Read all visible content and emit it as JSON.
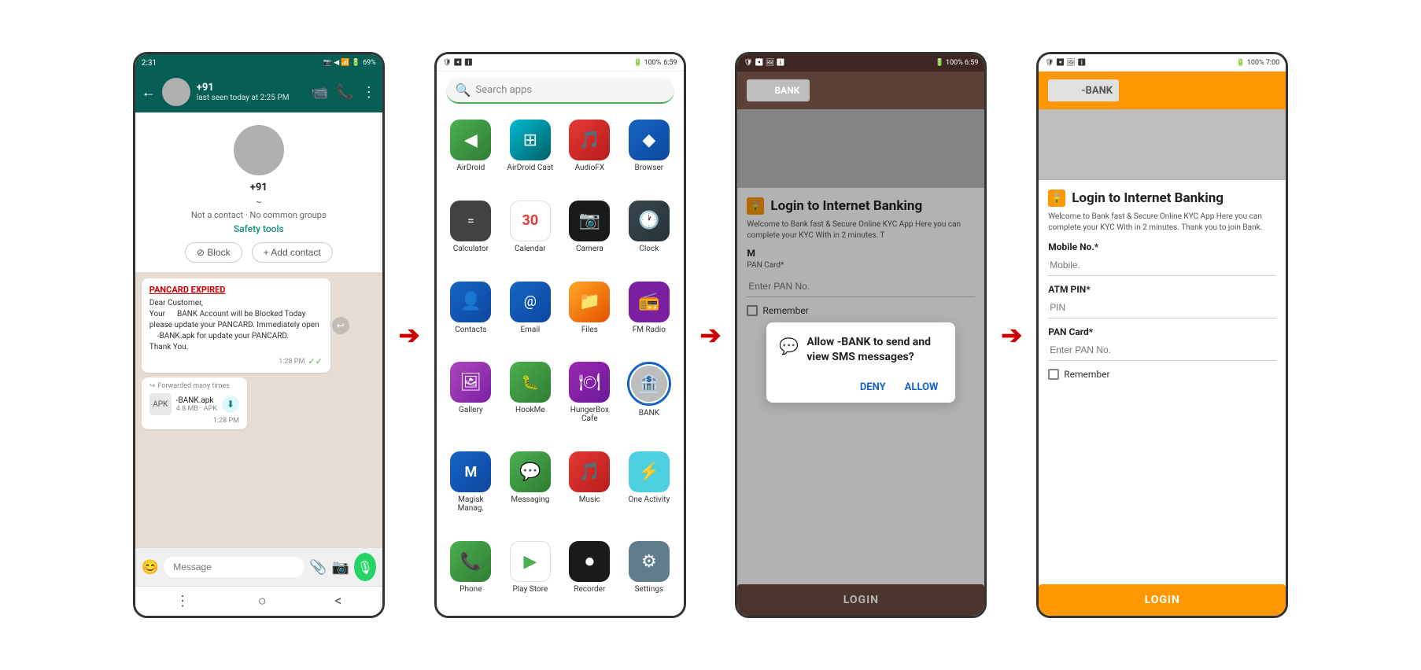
{
  "screen1": {
    "statusbar": {
      "time": "2:31",
      "battery": "69%"
    },
    "toolbar": {
      "back_label": "←",
      "contact_name": "+91",
      "contact_status": "last seen today at 2:25 PM",
      "video_icon": "📹",
      "phone_icon": "📞",
      "more_icon": "⋮"
    },
    "profile": {
      "phone_number": "+91",
      "tilde": "~",
      "no_contact_text": "Not a contact · No common groups",
      "safety_tools_label": "Safety tools"
    },
    "buttons": {
      "block_label": "⊘  Block",
      "add_contact_label": "+ Add contact"
    },
    "messages": [
      {
        "pancard_title": "PANCARD EXPIRED",
        "text": "Dear Customer,\nYour        BANK Account will be Blocked Today please update your PANCARD. Immediately open      -BANK.apk for update your PANCARD.\nThank You.",
        "time": "1:28 PM",
        "check": "✓✓"
      }
    ],
    "forwarded": {
      "label": "Forwarded many times",
      "filename": "-BANK.apk",
      "size": "4.8 MB · APK",
      "time": "1:28 PM"
    },
    "input_placeholder": "Message",
    "nav": {
      "menu": "⋮",
      "home": "○",
      "back": "<"
    }
  },
  "screen2": {
    "statusbar": {
      "icons_left": "🛡 ◀ ℹ",
      "time": "6:59",
      "battery": "100%"
    },
    "search_placeholder": "Search apps",
    "apps": [
      {
        "name": "AirDroid",
        "icon": "airdroid",
        "icon_char": "◀"
      },
      {
        "name": "AirDroid Cast",
        "icon": "airdroidcast",
        "icon_char": "⊞"
      },
      {
        "name": "AudioFX",
        "icon": "audiofx",
        "icon_char": "🎵"
      },
      {
        "name": "Browser",
        "icon": "browser",
        "icon_char": "◆"
      },
      {
        "name": "Calculator",
        "icon": "calculator",
        "icon_char": "="
      },
      {
        "name": "Calendar",
        "icon": "calendar",
        "icon_char": "30"
      },
      {
        "name": "Camera",
        "icon": "camera",
        "icon_char": "📷"
      },
      {
        "name": "Clock",
        "icon": "clock",
        "icon_char": "🕐"
      },
      {
        "name": "Contacts",
        "icon": "contacts",
        "icon_char": "👤"
      },
      {
        "name": "Email",
        "icon": "email",
        "icon_char": "@"
      },
      {
        "name": "Files",
        "icon": "files",
        "icon_char": "📁"
      },
      {
        "name": "FM Radio",
        "icon": "fmradio",
        "icon_char": "📻"
      },
      {
        "name": "Gallery",
        "icon": "gallery",
        "icon_char": "🖼"
      },
      {
        "name": "HookMe",
        "icon": "hookme",
        "icon_char": "🐛"
      },
      {
        "name": "HungerBox Cafe",
        "icon": "hungerbox",
        "icon_char": "🍽"
      },
      {
        "name": "BANK",
        "icon": "bank",
        "icon_char": "🏦",
        "highlighted": true
      },
      {
        "name": "Magisk Manag.",
        "icon": "magisk",
        "icon_char": "M"
      },
      {
        "name": "Messaging",
        "icon": "messaging",
        "icon_char": "💬"
      },
      {
        "name": "Music",
        "icon": "music",
        "icon_char": "🎵"
      },
      {
        "name": "One Activity",
        "icon": "oneactivity",
        "icon_char": "⚡"
      },
      {
        "name": "Phone",
        "icon": "phone",
        "icon_char": "📞"
      },
      {
        "name": "Play Store",
        "icon": "playstore",
        "icon_char": "▶"
      },
      {
        "name": "Recorder",
        "icon": "recorder",
        "icon_char": "⏺"
      },
      {
        "name": "Settings",
        "icon": "settings",
        "icon_char": "⚙"
      }
    ]
  },
  "screen3": {
    "statusbar": {
      "icons_left": "🛡 ◀ 🖼 ℹ",
      "time": "6:59",
      "battery": "100%"
    },
    "bank_name": "BANK",
    "hero_image": "",
    "section_title": "Login to Internet Banking",
    "welcome_text": "Welcome to        Bank fast & Secure Online KYC App Here you can complete your KYC With in 2 minutes. T",
    "mobile_label": "M",
    "pan_label": "PAN Card*",
    "pan_placeholder": "Enter PAN No.",
    "remember_label": "Remember",
    "login_button": "LOGIN",
    "dialog": {
      "icon": "💬",
      "title": "Allow      -BANK to send and view SMS messages?",
      "deny_label": "DENY",
      "allow_label": "ALLOW"
    }
  },
  "screen4": {
    "statusbar": {
      "icons_left": "🛡 ◀ 🖼 ℹ",
      "time": "7:00",
      "battery": "100%"
    },
    "bank_name": "-BANK",
    "bank_name_prefix": "",
    "hero_image": "",
    "section_title": "Login to Internet Banking",
    "welcome_text": "Welcome to        Bank fast & Secure Online KYC App Here you can complete your KYC With in 2 minutes. Thank you to join        Bank.",
    "mobile_label": "Mobile No.*",
    "mobile_placeholder": "Mobile.",
    "atm_label": "ATM PIN*",
    "atm_placeholder": "PIN",
    "pan_label": "PAN Card*",
    "pan_placeholder": "Enter PAN No.",
    "remember_label": "Remember",
    "login_button": "LOGIN"
  },
  "arrows": {
    "symbol": "➤"
  }
}
